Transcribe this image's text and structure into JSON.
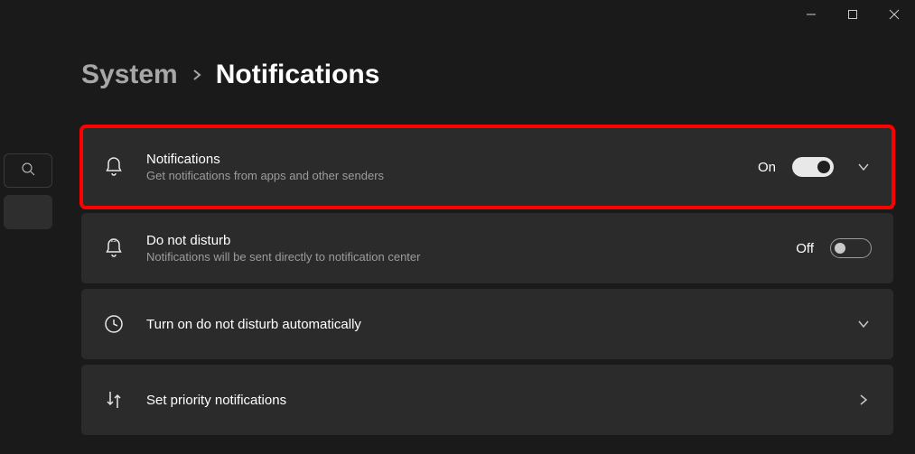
{
  "breadcrumb": {
    "parent": "System",
    "current": "Notifications"
  },
  "cards": {
    "notifications": {
      "title": "Notifications",
      "subtitle": "Get notifications from apps and other senders",
      "state_label": "On"
    },
    "dnd": {
      "title": "Do not disturb",
      "subtitle": "Notifications will be sent directly to notification center",
      "state_label": "Off"
    },
    "auto": {
      "title": "Turn on do not disturb automatically"
    },
    "priority": {
      "title": "Set priority notifications"
    }
  }
}
